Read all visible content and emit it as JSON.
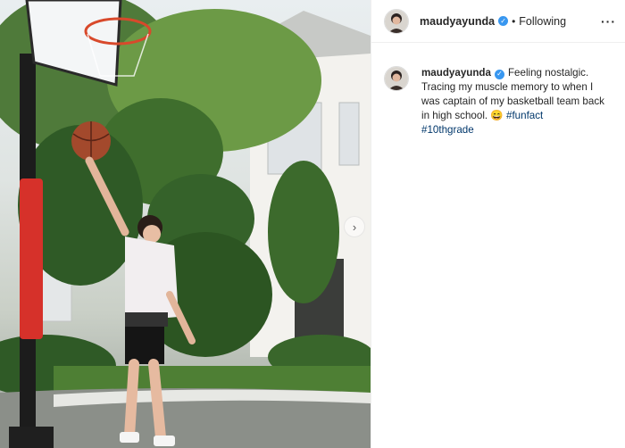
{
  "post": {
    "username": "maudyayunda",
    "follow_dot": "•",
    "follow_status": "Following",
    "more_glyph": "···",
    "verified_glyph": "✓",
    "caption_text": "Feeling nostalgic. Tracing my muscle memory to when I was captain of my basketball team back in high school. ",
    "emoji": "😄",
    "hashtags": [
      "#funfact",
      "#10thgrade"
    ],
    "carousel_next_glyph": "›"
  },
  "icons": {
    "verified": "verified-badge-icon",
    "more": "more-options-icon",
    "next": "carousel-next-icon",
    "emoji": "grinning-face-emoji-icon"
  },
  "colors": {
    "verified_blue": "#3897f0",
    "hashtag": "#00376b",
    "text": "#262626"
  }
}
